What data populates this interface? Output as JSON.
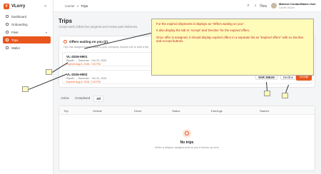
{
  "app": {
    "name": "VLorry",
    "logo_letter": "V"
  },
  "sidebar": {
    "items": [
      {
        "label": "Dashboard",
        "active": false
      },
      {
        "label": "Onboarding",
        "active": false
      },
      {
        "label": "Fleet",
        "active": false,
        "has_chevron": true
      },
      {
        "label": "Trips",
        "active": true
      },
      {
        "label": "Wallet",
        "active": false
      }
    ]
  },
  "topbar": {
    "breadcrumb": {
      "parent": "Carrier",
      "separator": ">",
      "current": "Trips"
    },
    "language": "EN",
    "user": {
      "name": "Mahesh ContactName User",
      "role": "Carrier Owner"
    }
  },
  "page": {
    "title": "Trips",
    "subtitle": "Accept work, follow live progress and review past deliveries."
  },
  "offers": {
    "heading": "Offers waiting on you (2)",
    "subtitle": "Ops has assigned these loads to your company. Accept one to start a trip.",
    "items": [
      {
        "id": "VL-2026-9901",
        "route": "Riyadh → Dammam · Oct 22, 2026",
        "expiry": "Expired Aug 8, 2026, 7:00 PM"
      },
      {
        "id": "VL-2026-9902",
        "route": "Riyadh → Dammam · Oct 22, 2026",
        "expiry": "Expired Aug 8, 2026, 7:00 PM",
        "price": "SAR 158.00",
        "decline_label": "Decline",
        "accept_label": "Accept"
      }
    ]
  },
  "tabs": [
    {
      "label": "Active",
      "active": false
    },
    {
      "label": "Completed",
      "active": false
    },
    {
      "label": "All",
      "active": true
    }
  ],
  "table": {
    "columns": [
      "Trip",
      "Vehicle",
      "Driver",
      "Status",
      "Earnings",
      "Started"
    ],
    "empty_title": "No trips",
    "empty_subtitle": "When a shipper assigns work to you it shows up here"
  },
  "annotation": {
    "lines": [
      "For the expired shipments it displays as \"Offers waiting on you\".",
      "It also display the tab to 'Accept' and 'Decline' for the expired offers.",
      "Once offer is assigned, it should display expired offers in a separate list as \"Expired offers\" with no Decline and Accept buttons."
    ]
  },
  "colors": {
    "accent": "#e8561d",
    "note_bg": "#fffbb8",
    "note_text": "#c02a2a"
  }
}
